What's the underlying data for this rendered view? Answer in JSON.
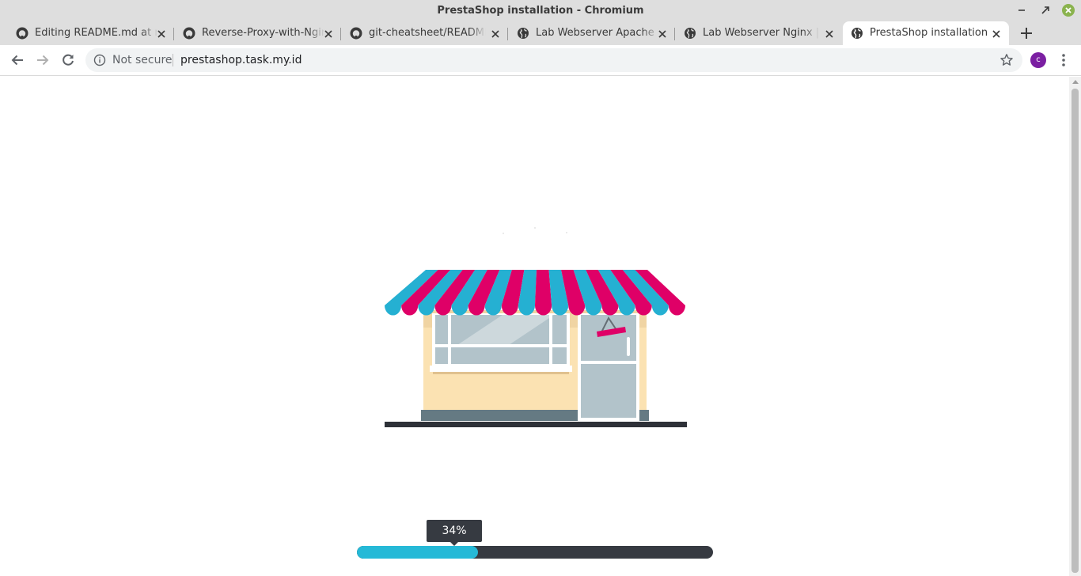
{
  "window": {
    "title": "PrestaShop installation - Chromium"
  },
  "tabs": [
    {
      "label": "Editing README.md at m",
      "favicon": "github-icon",
      "active": false
    },
    {
      "label": "Reverse-Proxy-with-Nginx",
      "favicon": "github-icon",
      "active": false
    },
    {
      "label": "git-cheatsheet/README.m",
      "favicon": "github-icon",
      "active": false
    },
    {
      "label": "Lab Webserver Apache | N",
      "favicon": "globe-icon",
      "active": false
    },
    {
      "label": "Lab Webserver Nginx | No",
      "favicon": "globe-icon",
      "active": false
    },
    {
      "label": "PrestaShop installation",
      "favicon": "globe-icon",
      "active": true
    }
  ],
  "address_bar": {
    "security_text": "Not secure",
    "url": "prestashop.task.my.id"
  },
  "profile": {
    "initial": "c",
    "color": "#7b1fa2"
  },
  "progress": {
    "label": "34%",
    "value": 0.34,
    "fill_color": "#25b9d7",
    "track_color": "#363a41"
  },
  "colors": {
    "awning_blue": "#25b0d2",
    "awning_pink": "#df0067",
    "wall": "#fbe2b2"
  }
}
